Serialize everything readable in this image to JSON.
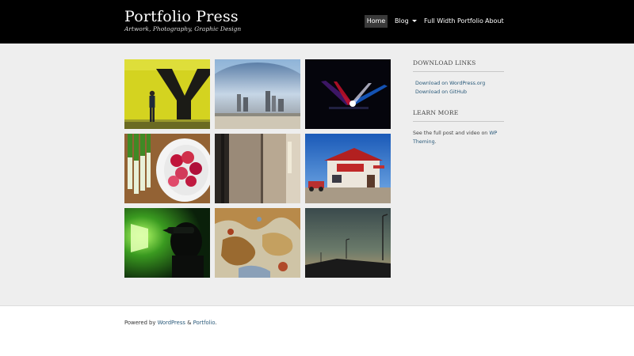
{
  "site": {
    "title": "Portfolio Press",
    "tagline": "Artwork, Photography, Graphic Design"
  },
  "nav": {
    "home": "Home",
    "blog": "Blog",
    "full_width": "Full Width Portfolio",
    "about": "About"
  },
  "gallery": {
    "items": [
      {
        "subject": "man standing in front of giant yellow Y sign"
      },
      {
        "subject": "reflective bean sculpture with city skyline"
      },
      {
        "subject": "concert stage lights in the dark"
      },
      {
        "subject": "radishes in a white bowl with green onions"
      },
      {
        "subject": "blurred elevator doors"
      },
      {
        "subject": "small roadside building under blue sky"
      },
      {
        "subject": "silhouette of person with cap in green light"
      },
      {
        "subject": "peeling painted wall texture"
      },
      {
        "subject": "dusk sky with street lamps"
      }
    ]
  },
  "sidebar": {
    "download": {
      "title": "DOWNLOAD LINKS",
      "links": [
        "Download on WordPress.org",
        "Download on GitHub"
      ]
    },
    "learn": {
      "title": "LEARN MORE",
      "text_before": "See the full post and video on",
      "link": "WP Theming",
      "text_after": "."
    }
  },
  "footer": {
    "prefix": "Powered by",
    "link1": "WordPress",
    "sep": "&",
    "link2": "Portfolio",
    "suffix": "."
  }
}
